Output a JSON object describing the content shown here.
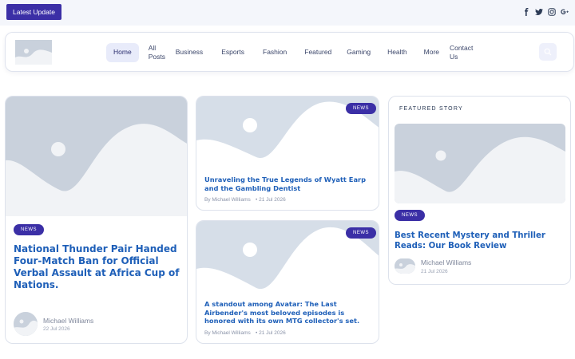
{
  "topbar": {
    "latest_label": "Latest Update",
    "socials": [
      "facebook-icon",
      "twitter-icon",
      "instagram-icon",
      "google-plus-icon"
    ]
  },
  "nav": {
    "items": [
      {
        "label": "Home",
        "active": true
      },
      {
        "label": "All Posts"
      },
      {
        "label": "Business"
      },
      {
        "label": "Esports"
      },
      {
        "label": "Fashion"
      },
      {
        "label": "Featured"
      },
      {
        "label": "Gaming"
      },
      {
        "label": "Health"
      },
      {
        "label": "More"
      },
      {
        "label": "Contact Us"
      }
    ]
  },
  "main_post": {
    "badge": "NEWS",
    "title": "National Thunder Pair Handed Four-Match Ban for Official Verbal Assault at Africa Cup of Nations.",
    "author": "Michael Williams",
    "date": "22 Jul 2026"
  },
  "mid_posts": [
    {
      "badge": "NEWS",
      "title": "Unraveling the True Legends of Wyatt Earp and the Gambling Dentist",
      "author": "By Michael Williams",
      "date": "• 21 Jul 2026"
    },
    {
      "badge": "NEWS",
      "title": "A standout among Avatar: The Last Airbender's most beloved episodes is honored with its own MTG collector's set.",
      "author": "By Michael Williams",
      "date": "• 21 Jul 2026"
    }
  ],
  "featured": {
    "label": "FEATURED STORY",
    "badge": "NEWS",
    "title": "Best Recent Mystery and Thriller Reads: Our Book Review",
    "author": "Michael Williams",
    "date": "21 Jul 2026"
  },
  "colors": {
    "accent": "#3b2fa6",
    "title": "#1e5fb8",
    "placeholder_bg": "#c9d1dc",
    "placeholder_fg": "#f1f3f6"
  }
}
